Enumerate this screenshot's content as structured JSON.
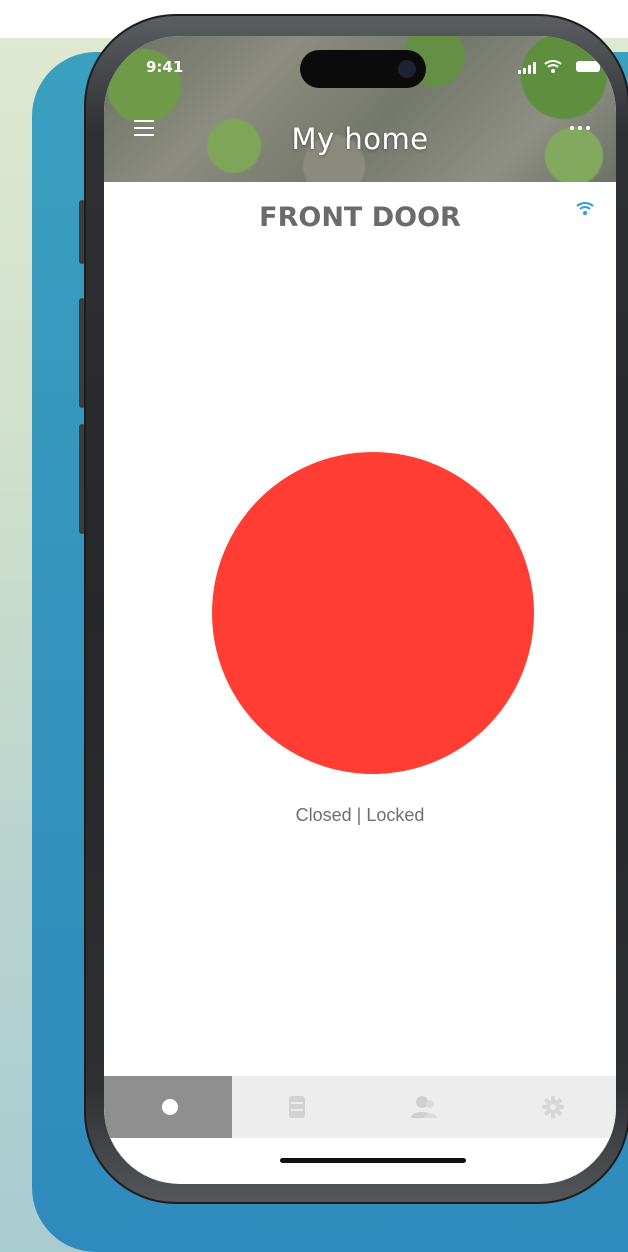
{
  "status_bar": {
    "time": "9:41",
    "icons": [
      "cellular-signal-icon",
      "wifi-icon",
      "battery-icon"
    ]
  },
  "header": {
    "title": "My home",
    "left_icon": "hamburger-menu-icon",
    "right_icon": "more-options-icon"
  },
  "door": {
    "name": "FRONT DOOR",
    "connection_icon": "wifi-icon",
    "connection_color": "#1fa3d6"
  },
  "lock": {
    "status": "Closed | Locked",
    "button_color": "#ff3d33"
  },
  "tabbar": {
    "tabs": [
      {
        "icon": "lock-control-icon",
        "active": true
      },
      {
        "icon": "log-list-icon",
        "active": false
      },
      {
        "icon": "users-icon",
        "active": false
      },
      {
        "icon": "settings-gear-icon",
        "active": false
      }
    ]
  },
  "colors": {
    "accent_blue": "#3593bd",
    "background_gradient_top": "#dfe8d0",
    "tab_active": "#8f8f8f",
    "tab_bar": "#ededed"
  }
}
